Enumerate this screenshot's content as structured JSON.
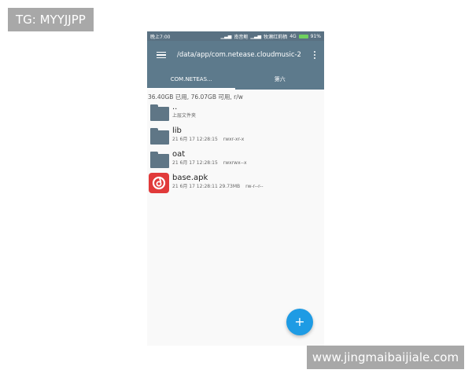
{
  "watermarks": {
    "top_left": "TG: MYYJJPP",
    "bottom_right": "www.jingmaibaijiale.com"
  },
  "status_bar": {
    "time": "晚上7:00",
    "carrier1": "南音鲍",
    "carrier2": "牧濑红莉栖",
    "network": "4G",
    "battery": "91%"
  },
  "app_bar": {
    "path": "/data/app/com.netease.cloudmusic-2",
    "menu_icon": "hamburger-icon",
    "more_icon": "more-vert-icon"
  },
  "tabs": [
    {
      "label": "COM.NETEAS...",
      "active": true
    },
    {
      "label": "第六",
      "active": false
    }
  ],
  "storage_info": "36.40GB 已用, 76.07GB 可用, r/w",
  "files": [
    {
      "name": "..",
      "meta": "上层文件夹",
      "perm": "",
      "type": "folder"
    },
    {
      "name": "lib",
      "meta": "21 6月 17 12:28:15",
      "perm": "rwxr-xr-x",
      "type": "folder"
    },
    {
      "name": "oat",
      "meta": "21 6月 17 12:28:15",
      "perm": "rwxrwx--x",
      "type": "folder"
    },
    {
      "name": "base.apk",
      "meta": "21 6月 17 12:28:11  29.73MB",
      "perm": "rw-r--r--",
      "type": "apk"
    }
  ],
  "fab": {
    "label": "+",
    "color": "#1e9be4"
  },
  "colors": {
    "appbar": "#5d7a8c",
    "folder": "#5f7686",
    "apk": "#e13a3a"
  }
}
